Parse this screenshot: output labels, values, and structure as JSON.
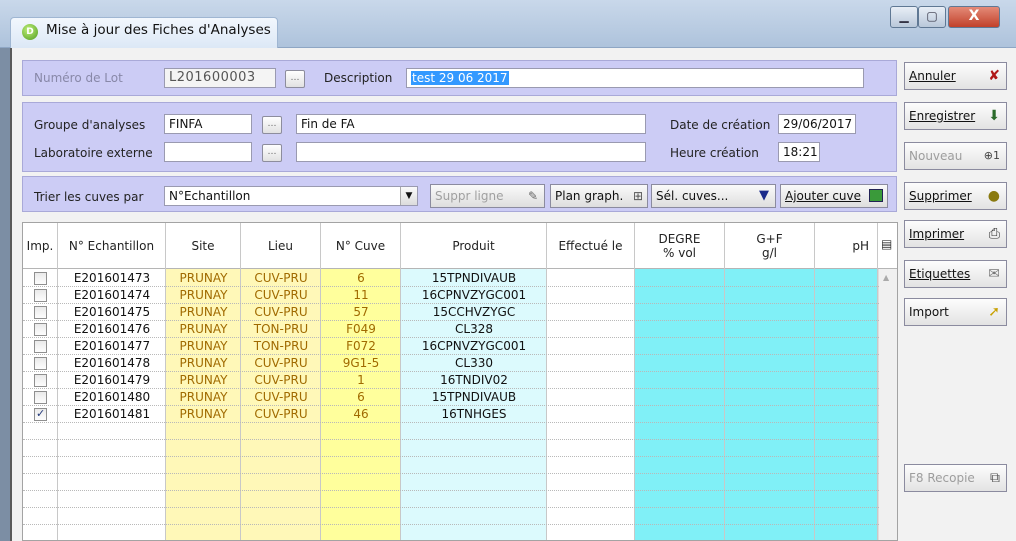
{
  "window": {
    "title": "Mise à jour des Fiches d'Analyses",
    "app_icon": "app-logo-icon",
    "min_glyph": "▁",
    "max_glyph": "▢",
    "close_glyph": "X"
  },
  "lot": {
    "numero_label": "Numéro de Lot",
    "numero_value": "L201600003",
    "description_label": "Description",
    "description_value": "test 29 06 2017"
  },
  "group": {
    "groupe_label": "Groupe d'analyses",
    "groupe_code": "FINFA",
    "groupe_name": "Fin de FA",
    "labo_label": "Laboratoire externe",
    "labo_code": "",
    "labo_name": "",
    "date_label": "Date de création",
    "date_value": "29/06/2017",
    "heure_label": "Heure création",
    "heure_value": "18:21"
  },
  "sort": {
    "label": "Trier les cuves par",
    "selected": "N°Echantillon",
    "suppr_label": "Suppr ligne",
    "plan_label": "Plan graph.",
    "sel_label": "Sél. cuves...",
    "ajouter_label": "Ajouter cuve"
  },
  "side_buttons": {
    "annuler": "Annuler",
    "enregistrer": "Enregistrer",
    "nouveau": "Nouveau",
    "supprimer": "Supprimer",
    "imprimer": "Imprimer",
    "etiquettes": "Etiquettes",
    "import": "Import",
    "f8": "F8 Recopie"
  },
  "table": {
    "headers": {
      "imp": "Imp.",
      "echantillon": "N° Echantillon",
      "site": "Site",
      "lieu": "Lieu",
      "cuve": "N° Cuve",
      "produit": "Produit",
      "effectue": "Effectué le",
      "degre_1": "DEGRE",
      "degre_2": "% vol",
      "gf_1": "G+F",
      "gf_2": "g/l",
      "ph": "pH"
    },
    "rows": [
      {
        "checked": false,
        "echantillon": "E201601473",
        "site": "PRUNAY",
        "lieu": "CUV-PRU",
        "cuve": "6",
        "produit": "15TPNDIVAUB"
      },
      {
        "checked": false,
        "echantillon": "E201601474",
        "site": "PRUNAY",
        "lieu": "CUV-PRU",
        "cuve": "11",
        "produit": "16CPNVZYGC001"
      },
      {
        "checked": false,
        "echantillon": "E201601475",
        "site": "PRUNAY",
        "lieu": "CUV-PRU",
        "cuve": "57",
        "produit": "15CCHVZYGC"
      },
      {
        "checked": false,
        "echantillon": "E201601476",
        "site": "PRUNAY",
        "lieu": "TON-PRU",
        "cuve": "F049",
        "produit": "CL328"
      },
      {
        "checked": false,
        "echantillon": "E201601477",
        "site": "PRUNAY",
        "lieu": "TON-PRU",
        "cuve": "F072",
        "produit": "16CPNVZYGC001"
      },
      {
        "checked": false,
        "echantillon": "E201601478",
        "site": "PRUNAY",
        "lieu": "CUV-PRU",
        "cuve": "9G1-5",
        "produit": "CL330"
      },
      {
        "checked": false,
        "echantillon": "E201601479",
        "site": "PRUNAY",
        "lieu": "CUV-PRU",
        "cuve": "1",
        "produit": "16TNDIV02"
      },
      {
        "checked": false,
        "echantillon": "E201601480",
        "site": "PRUNAY",
        "lieu": "CUV-PRU",
        "cuve": "6",
        "produit": "15TPNDIVAUB"
      },
      {
        "checked": true,
        "echantillon": "E201601481",
        "site": "PRUNAY",
        "lieu": "CUV-PRU",
        "cuve": "46",
        "produit": "16TNHGES"
      }
    ]
  },
  "colors": {
    "panel": "#ccccf5",
    "site_lieu_col": "#fff8b8",
    "cuve_col": "#ffff9c",
    "produit_col": "#dcfafd",
    "result_col": "#80f0f7",
    "site_text": "#a06a00"
  }
}
